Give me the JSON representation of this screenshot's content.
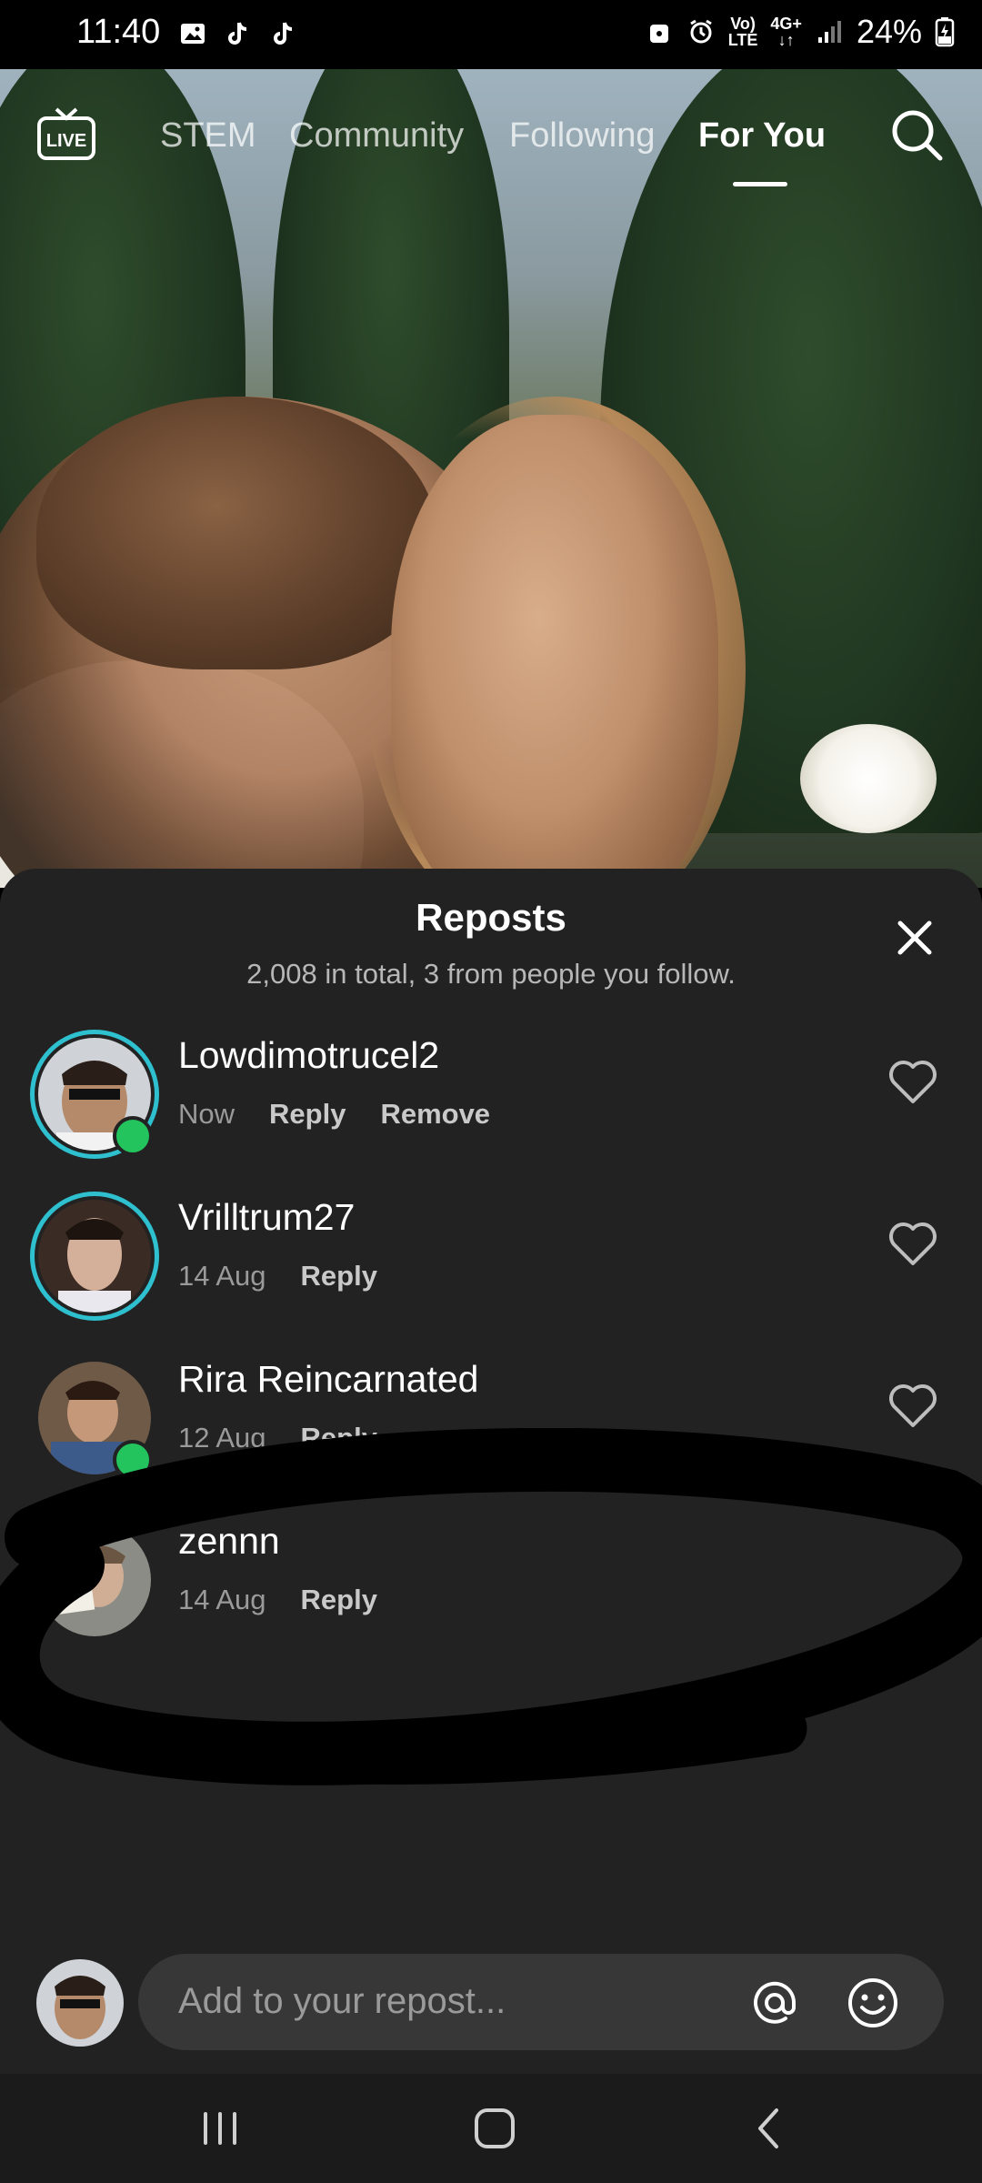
{
  "status_bar": {
    "time": "11:40",
    "network_top": "Vo)",
    "network_bottom": "LTE",
    "data_top": "4G+",
    "battery": "24%"
  },
  "top_nav": {
    "live_label": "LIVE",
    "tabs": [
      {
        "label": "STEM",
        "active": false
      },
      {
        "label": "Community",
        "active": false
      },
      {
        "label": "Following",
        "active": false
      },
      {
        "label": "For You",
        "active": true
      }
    ]
  },
  "sheet": {
    "title": "Reposts",
    "subtitle": "2,008 in total, 3 from people you follow.",
    "reposts": [
      {
        "name": "Lowdimotrucel2",
        "time": "Now",
        "actions": [
          "Reply",
          "Remove"
        ],
        "story_ring": true,
        "online": true
      },
      {
        "name": "Vrilltrum27",
        "time": "14 Aug",
        "actions": [
          "Reply"
        ],
        "story_ring": true,
        "online": false
      },
      {
        "name": "Rira Reincarnated",
        "time": "12 Aug",
        "actions": [
          "Reply"
        ],
        "story_ring": false,
        "online": true
      },
      {
        "name": "zennn",
        "time": "14 Aug",
        "actions": [
          "Reply"
        ],
        "story_ring": false,
        "online": false
      }
    ]
  },
  "composer": {
    "placeholder": "Add to your repost..."
  },
  "colors": {
    "sheet_bg": "#222222",
    "story_ring": "#2fc0cf",
    "online_dot": "#23c45e",
    "input_bg": "#373737"
  }
}
